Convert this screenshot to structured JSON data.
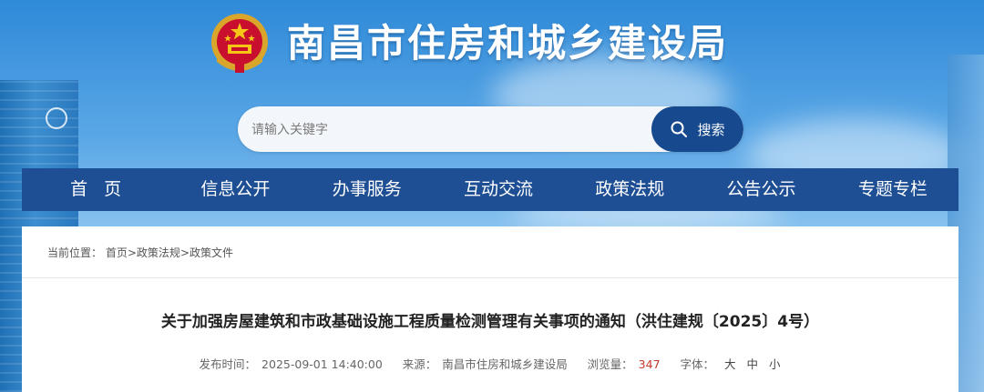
{
  "header": {
    "title": "南昌市住房和城乡建设局",
    "emblem_icon": "national-emblem-icon"
  },
  "search": {
    "placeholder": "请输入关键字",
    "button_label": "搜索",
    "button_icon": "search-icon"
  },
  "nav": {
    "items": [
      "首页",
      "信息公开",
      "办事服务",
      "互动交流",
      "政策法规",
      "公告公示",
      "专题专栏"
    ]
  },
  "breadcrumb": {
    "prefix": "当前位置：",
    "items": [
      "首页",
      "政策法规",
      "政策文件"
    ],
    "separator": ">"
  },
  "article": {
    "title": "关于加强房屋建筑和市政基础设施工程质量检测管理有关事项的通知（洪住建规〔2025〕4号）",
    "publish_label": "发布时间：",
    "publish_time": "2025-09-01 14:40:00",
    "source_label": "来源：",
    "source": "南昌市住房和城乡建设局",
    "views_label": "浏览量：",
    "views": "347",
    "font_label": "字体：",
    "font_sizes": [
      "大",
      "中",
      "小"
    ]
  },
  "colors": {
    "nav_bg": "#1e4f94",
    "search_button": "#17498f",
    "views_accent": "#c0392b"
  }
}
